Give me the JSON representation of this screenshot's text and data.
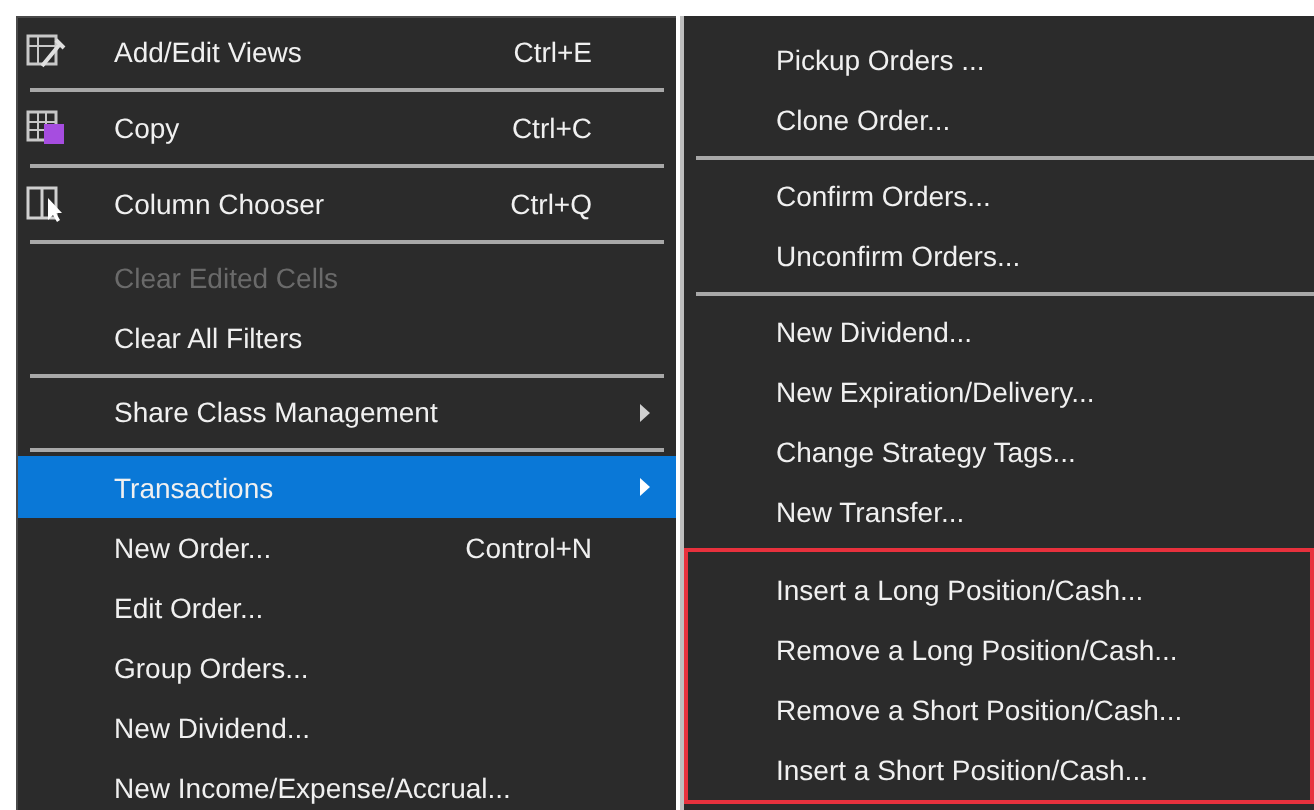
{
  "context_menu": {
    "groups": [
      {
        "items": [
          {
            "label": "Add/Edit Views",
            "shortcut": "Ctrl+E",
            "kind": "views",
            "disabled": false,
            "selected": false,
            "submenu": false
          }
        ]
      },
      {
        "items": [
          {
            "label": "Copy",
            "shortcut": "Ctrl+C",
            "kind": "copy",
            "disabled": false,
            "selected": false,
            "submenu": false
          }
        ]
      },
      {
        "items": [
          {
            "label": "Column Chooser",
            "shortcut": "Ctrl+Q",
            "kind": "columns",
            "disabled": false,
            "selected": false,
            "submenu": false
          }
        ]
      },
      {
        "items": [
          {
            "label": "Clear Edited Cells",
            "kind": "plain",
            "disabled": true,
            "selected": false,
            "submenu": false
          },
          {
            "label": "Clear All Filters",
            "kind": "plain",
            "disabled": false,
            "selected": false,
            "submenu": false
          }
        ]
      },
      {
        "items": [
          {
            "label": "Share Class Management",
            "kind": "plain",
            "disabled": false,
            "selected": false,
            "submenu": true
          }
        ]
      },
      {
        "items": [
          {
            "label": "Transactions",
            "kind": "plain",
            "disabled": false,
            "selected": true,
            "submenu": true
          },
          {
            "label": "New Order...",
            "shortcut": "Control+N",
            "kind": "plain",
            "disabled": false,
            "selected": false,
            "submenu": false
          },
          {
            "label": "Edit Order...",
            "kind": "plain",
            "disabled": false,
            "selected": false,
            "submenu": false
          },
          {
            "label": "Group Orders...",
            "kind": "plain",
            "disabled": false,
            "selected": false,
            "submenu": false
          },
          {
            "label": "New Dividend...",
            "kind": "plain",
            "disabled": false,
            "selected": false,
            "submenu": false
          },
          {
            "label": "New Income/Expense/Accrual...",
            "kind": "plain",
            "disabled": false,
            "selected": false,
            "submenu": false
          }
        ]
      }
    ]
  },
  "submenu": {
    "groups": [
      {
        "highlighted": false,
        "items": [
          "Pickup Orders ...",
          "Clone Order..."
        ]
      },
      {
        "highlighted": false,
        "items": [
          "Confirm Orders...",
          "Unconfirm Orders..."
        ]
      },
      {
        "highlighted": false,
        "items": [
          "New Dividend...",
          "New Expiration/Delivery...",
          "Change Strategy Tags...",
          "New Transfer..."
        ]
      },
      {
        "highlighted": true,
        "items": [
          "Insert a Long Position/Cash...",
          "Remove a Long Position/Cash...",
          "Remove a Short Position/Cash...",
          "Insert a Short Position/Cash..."
        ]
      }
    ]
  }
}
